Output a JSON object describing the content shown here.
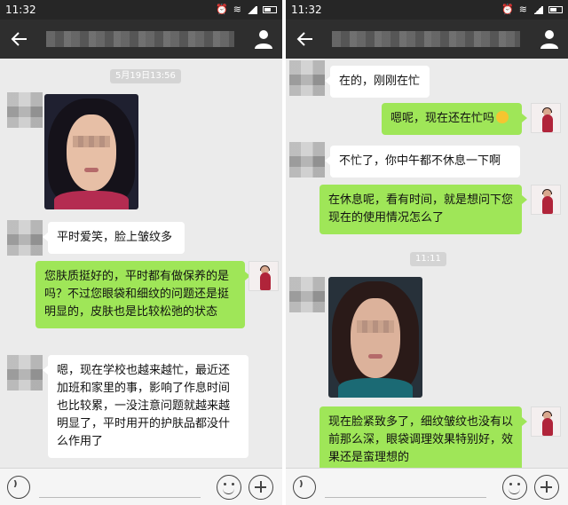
{
  "left_screen": {
    "status_time": "11:32",
    "timestamp": "5月19日13:56",
    "messages": [
      {
        "dir": "in",
        "text": "平时爱笑，脸上皱纹多"
      },
      {
        "dir": "out",
        "text": "您肤质挺好的，平时都有做保养的是吗？不过您眼袋和细纹的问题还是挺明显的，皮肤也是比较松弛的状态"
      },
      {
        "dir": "in",
        "text": "嗯，现在学校也越来越忙，最近还加班和家里的事，影响了作息时间也比较累，一没注意问题就越来越明显了，平时用开的护肤品都没什么作用了"
      }
    ]
  },
  "right_screen": {
    "status_time": "11:32",
    "timestamp": "11:11",
    "messages": [
      {
        "dir": "in",
        "text": "在的，刚刚在忙"
      },
      {
        "dir": "out",
        "text": "嗯呢，现在还在忙吗"
      },
      {
        "dir": "in",
        "text": "不忙了，你中午都不休息一下啊"
      },
      {
        "dir": "out",
        "text": "在休息呢，看有时间，就是想问下您现在的使用情况怎么了"
      },
      {
        "dir": "out",
        "text": "现在脸紧致多了，细纹皱纹也没有以前那么深，眼袋调理效果特别好，效果还是蛮理想的"
      }
    ]
  },
  "icons": {
    "back": "back-arrow-icon",
    "profile": "person-icon",
    "voice": "voice-icon",
    "emoji": "emoji-icon",
    "plus": "plus-icon"
  }
}
